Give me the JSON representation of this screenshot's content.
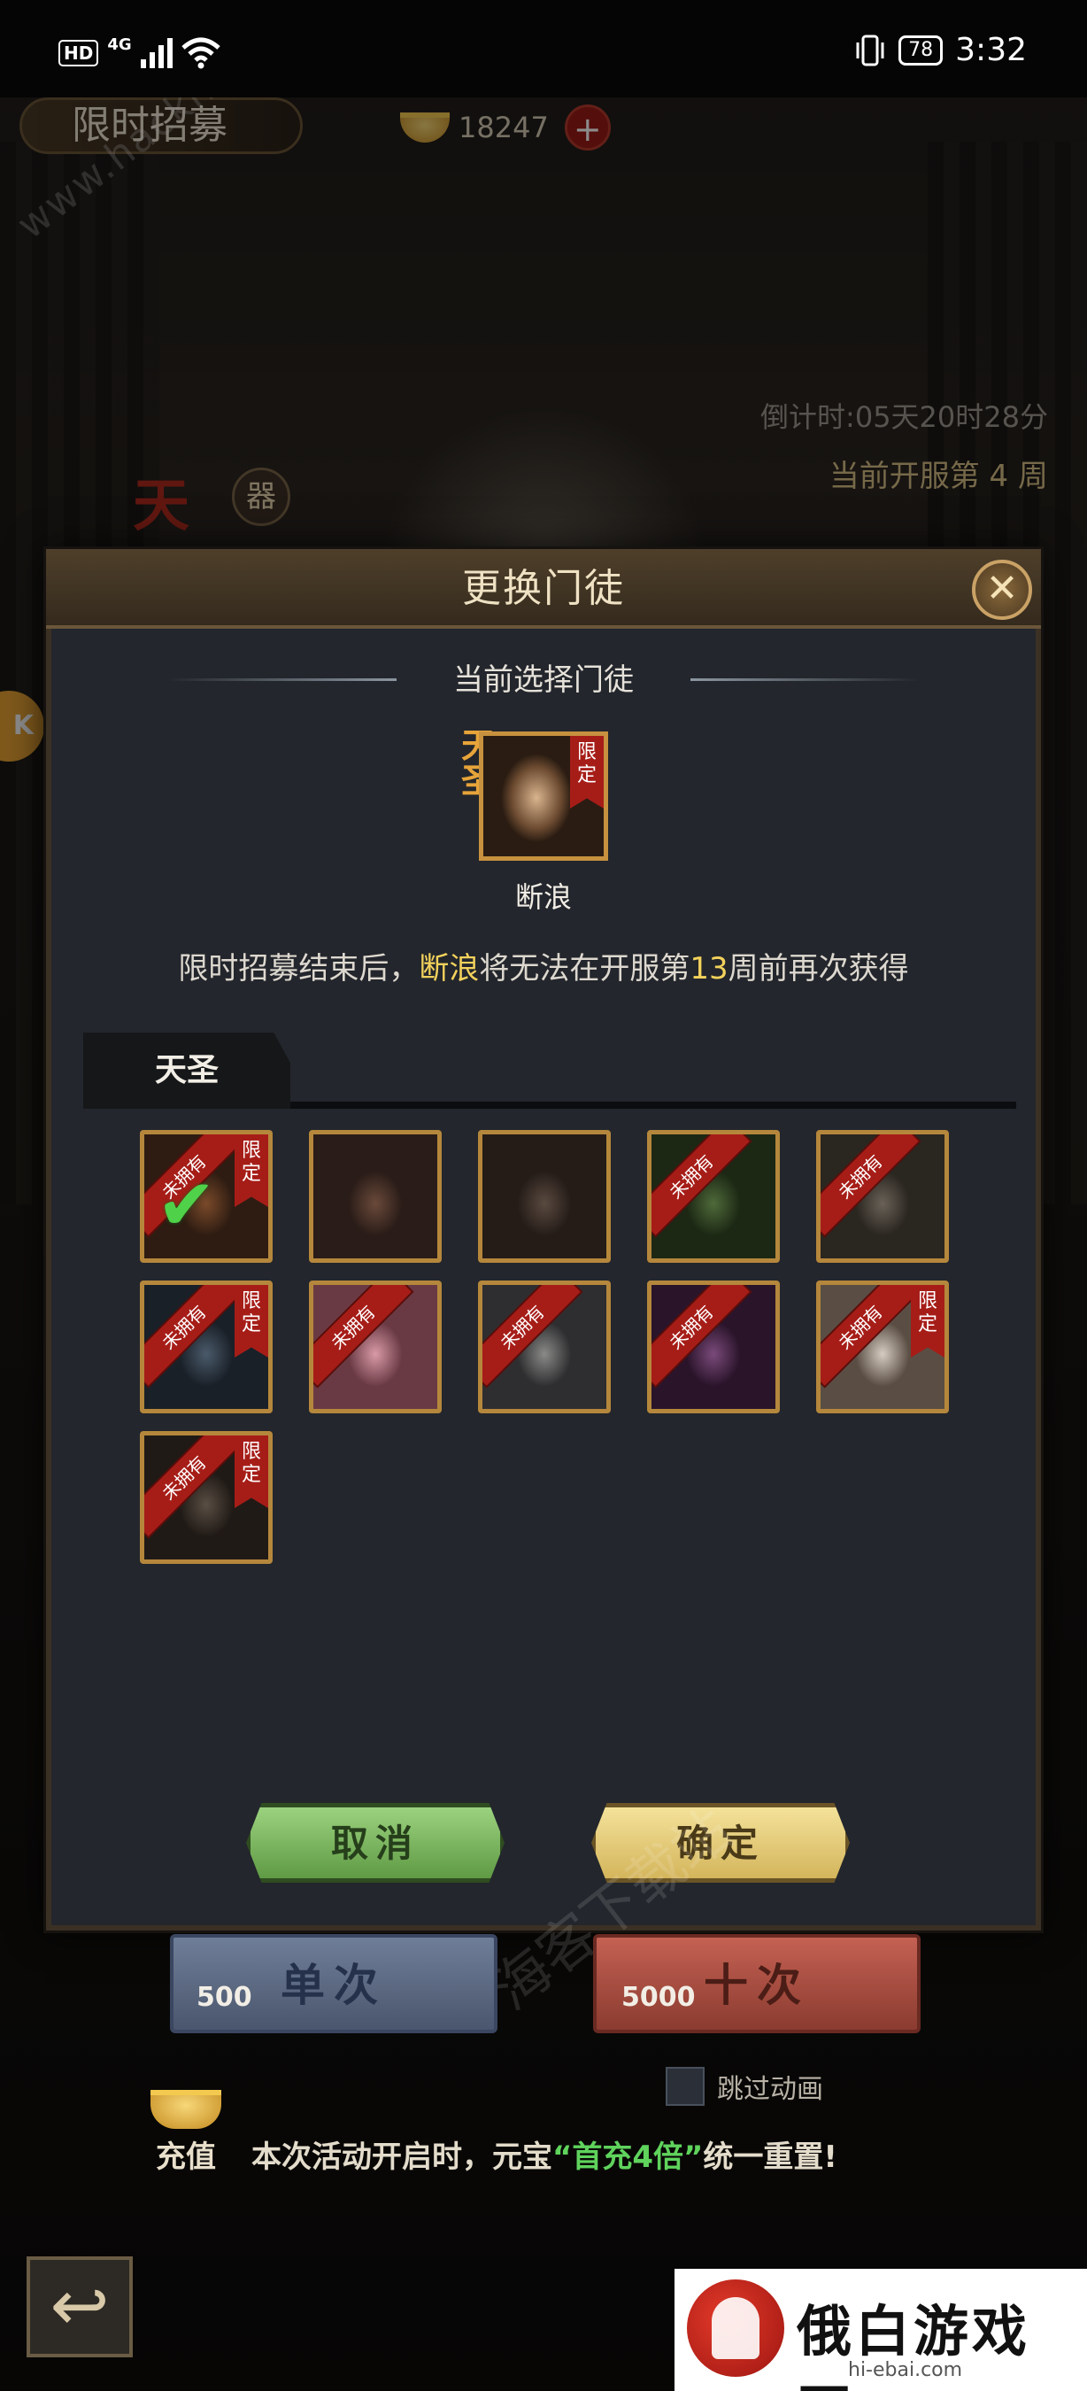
{
  "status_bar": {
    "hd": "HD",
    "network": "4G",
    "battery": "78",
    "time": "3:32"
  },
  "header": {
    "title": "限时招募",
    "gold": "18247",
    "add_label": "+"
  },
  "event": {
    "countdown": "倒计时:05天20时28分",
    "week": "当前开服第 4 周",
    "side_title": "天",
    "side_badge": "器"
  },
  "modal": {
    "title": "更换门徒",
    "close_label": "✕",
    "section_title": "当前选择门徒",
    "current": {
      "name": "断浪",
      "rank": "天圣",
      "tag": "限定"
    },
    "info_prefix": "限时招募结束后，",
    "info_name": "断浪",
    "info_mid": "将无法在开服第",
    "info_week": "13",
    "info_suffix": "周前再次获得",
    "tab_label": "天圣",
    "disciples": [
      {
        "tag": "限定",
        "unowned": "未拥有",
        "selected": true,
        "colors": [
          "#7a4a2a",
          "#2e1c12"
        ]
      },
      {
        "tag": "",
        "unowned": "",
        "selected": false,
        "colors": [
          "#6a4a3a",
          "#2a1c18"
        ]
      },
      {
        "tag": "",
        "unowned": "",
        "selected": false,
        "colors": [
          "#5a4a40",
          "#251c18"
        ]
      },
      {
        "tag": "",
        "unowned": "未拥有",
        "selected": false,
        "colors": [
          "#4f6a3a",
          "#1c2814"
        ]
      },
      {
        "tag": "",
        "unowned": "未拥有",
        "selected": false,
        "colors": [
          "#6a6258",
          "#2a2620"
        ]
      },
      {
        "tag": "限定",
        "unowned": "未拥有",
        "selected": false,
        "colors": [
          "#4a5a6a",
          "#1a2028"
        ]
      },
      {
        "tag": "",
        "unowned": "未拥有",
        "selected": false,
        "colors": [
          "#d89aa6",
          "#6a3a44"
        ]
      },
      {
        "tag": "",
        "unowned": "未拥有",
        "selected": false,
        "colors": [
          "#8a8a88",
          "#2e2e30"
        ]
      },
      {
        "tag": "",
        "unowned": "未拥有",
        "selected": false,
        "colors": [
          "#7a4a7a",
          "#2a142a"
        ]
      },
      {
        "tag": "限定",
        "unowned": "未拥有",
        "selected": false,
        "colors": [
          "#d6ccc0",
          "#5a4e44"
        ]
      },
      {
        "tag": "限定",
        "unowned": "未拥有",
        "selected": false,
        "colors": [
          "#5a4e44",
          "#201a16"
        ]
      }
    ],
    "cancel_label": "取消",
    "ok_label": "确定"
  },
  "draw": {
    "single_label": "单次",
    "single_cost": "500",
    "ten_label": "十次",
    "ten_cost": "5000",
    "skip_label": "跳过动画"
  },
  "footer": {
    "recharge_label": "充值",
    "notice_prefix": "本次活动开启时，元宝",
    "notice_highlight": "“首充4倍”",
    "notice_suffix": "统一重置!",
    "back_label": "↩"
  },
  "watermarks": {
    "site": "www.hackhome.com",
    "site_mid": "海客下载站",
    "brand_name": "俄白游戏网",
    "brand_url": "hi-ebai.com"
  },
  "colors": {
    "gold_frame": "#b5873c",
    "tag_red": "#a61d18",
    "check_green": "#4fd14a",
    "highlight_yellow": "#f3d25c"
  }
}
